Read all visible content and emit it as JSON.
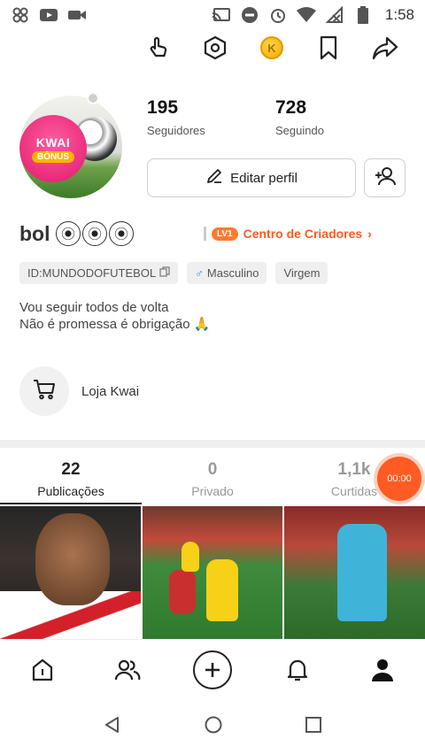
{
  "status_bar": {
    "time": "1:58",
    "icons": [
      "pinwheel-icon",
      "youtube-icon",
      "video-icon",
      "cast-icon",
      "dnd-icon",
      "alarm-icon",
      "wifi-icon",
      "no-signal-icon",
      "battery-icon"
    ]
  },
  "toolbar": {
    "icons": [
      "hand-icon",
      "settings-hex-icon",
      "coin-icon",
      "bookmark-icon",
      "share-icon"
    ],
    "coin_glyph": "K"
  },
  "avatar": {
    "badge_line1": "KWAI",
    "badge_line2": "BÔNUS"
  },
  "stats": {
    "followers_count": "195",
    "followers_label": "Seguidores",
    "following_count": "728",
    "following_label": "Seguindo"
  },
  "actions": {
    "edit_label": "Editar perfil"
  },
  "profile": {
    "name": "bol",
    "level_badge": "LV1",
    "creator_center": "Centro de Criadores",
    "creator_arrow": "›",
    "tags": {
      "id": "ID:MUNDODOFUTEBOL",
      "gender_symbol": "♂",
      "gender": "Masculino",
      "sign": "Virgem"
    },
    "bio_line1": "Vou seguir todos de volta",
    "bio_line2": "Não é promessa é obrigação 🙏"
  },
  "shop": {
    "label": "Loja Kwai"
  },
  "tabs": [
    {
      "count": "22",
      "label": "Publicações"
    },
    {
      "count": "0",
      "label": "Privado"
    },
    {
      "count": "1,1k",
      "label": "Curtidas"
    }
  ],
  "record_timer": "00:00",
  "bottom_nav": [
    "home-icon",
    "friends-icon",
    "create-icon",
    "bell-icon",
    "profile-icon"
  ],
  "android_nav": [
    "back-icon",
    "home-circle-icon",
    "recents-icon"
  ]
}
